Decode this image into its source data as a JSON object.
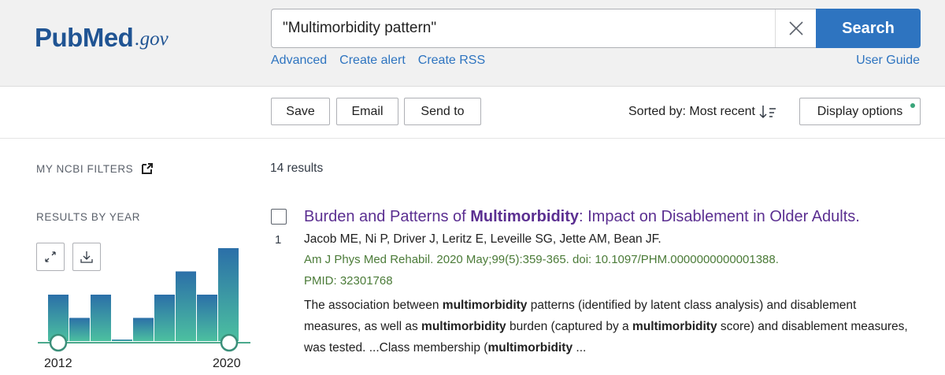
{
  "logo": {
    "pub": "Pub",
    "med": "Med",
    "gov": ".gov"
  },
  "search": {
    "query": "\"Multimorbidity pattern\"",
    "button_label": "Search"
  },
  "header_links": {
    "advanced": "Advanced",
    "create_alert": "Create alert",
    "create_rss": "Create RSS",
    "user_guide": "User Guide"
  },
  "toolbar": {
    "save": "Save",
    "email": "Email",
    "send_to": "Send to",
    "sorted_by": "Sorted by: Most recent",
    "display_options": "Display options"
  },
  "sidebar": {
    "my_ncbi_filters": "MY NCBI FILTERS",
    "results_by_year": "RESULTS BY YEAR",
    "year_start": "2012",
    "year_end": "2020"
  },
  "results_by_year_data": {
    "type": "bar",
    "year_start": 2012,
    "year_end": 2020,
    "values": [
      2,
      1,
      2,
      0,
      1,
      2,
      3,
      2,
      4
    ],
    "color_top": "#2b6fa8",
    "color_bottom": "#4cc0a0"
  },
  "results_count": "14 results",
  "results": [
    {
      "number": "1",
      "title_pre": "Burden and Patterns of ",
      "title_bold": "Multimorbidity",
      "title_post": ": Impact on Disablement in Older Adults.",
      "authors": "Jacob ME, Ni P, Driver J, Leritz E, Leveille SG, Jette AM, Bean JF.",
      "citation": "Am J Phys Med Rehabil. 2020 May;99(5):359-365. doi: 10.1097/PHM.0000000000001388.",
      "pmid": "PMID: 32301768",
      "snippet": {
        "s1": "The association between ",
        "b1": "multimorbidity",
        "s2": " patterns (identified by latent class analysis) and disablement measures, as well as ",
        "b2": "multimorbidity",
        "s3": " burden (captured by a ",
        "b3": "multimorbidity",
        "s4": " score) and disablement measures, was tested. ...Class membership (",
        "b4": "multimorbidity",
        "s5": " ..."
      }
    }
  ]
}
